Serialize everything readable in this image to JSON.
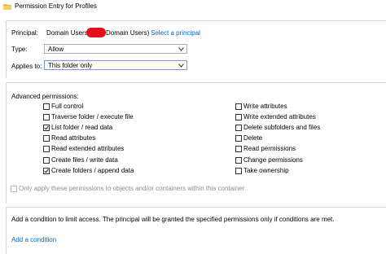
{
  "window": {
    "title": "Permission Entry for Profiles"
  },
  "principal": {
    "label": "Principal:",
    "value_prefix": "Domain Users",
    "value_suffix": "Domain Users)",
    "select_link": "Select a principal"
  },
  "type": {
    "label": "Type:",
    "value": "Allow"
  },
  "applies_to": {
    "label": "Applies to:",
    "value": "This folder only"
  },
  "advanced": {
    "heading": "Advanced permissions:",
    "left": [
      {
        "label": "Full control",
        "checked": false
      },
      {
        "label": "Traverse folder / execute file",
        "checked": false
      },
      {
        "label": "List folder / read data",
        "checked": true
      },
      {
        "label": "Read attributes",
        "checked": false
      },
      {
        "label": "Read extended attributes",
        "checked": false
      },
      {
        "label": "Create files / write data",
        "checked": false
      },
      {
        "label": "Create folders / append data",
        "checked": true
      }
    ],
    "right": [
      {
        "label": "Write attributes",
        "checked": false
      },
      {
        "label": "Write extended attributes",
        "checked": false
      },
      {
        "label": "Delete subfolders and files",
        "checked": false
      },
      {
        "label": "Delete",
        "checked": false
      },
      {
        "label": "Read permissions",
        "checked": false
      },
      {
        "label": "Change permissions",
        "checked": false
      },
      {
        "label": "Take ownership",
        "checked": false
      }
    ],
    "only_apply": {
      "label": "Only apply these permissions to objects and/or containers within this container",
      "checked": false,
      "disabled": true
    }
  },
  "condition": {
    "description": "Add a condition to limit access. The principal will be granted the specified permissions only if conditions are met.",
    "add_link": "Add a condition"
  },
  "colors": {
    "link": "#0066cc",
    "redaction": "#e3101c",
    "border": "#d6d6d6"
  }
}
